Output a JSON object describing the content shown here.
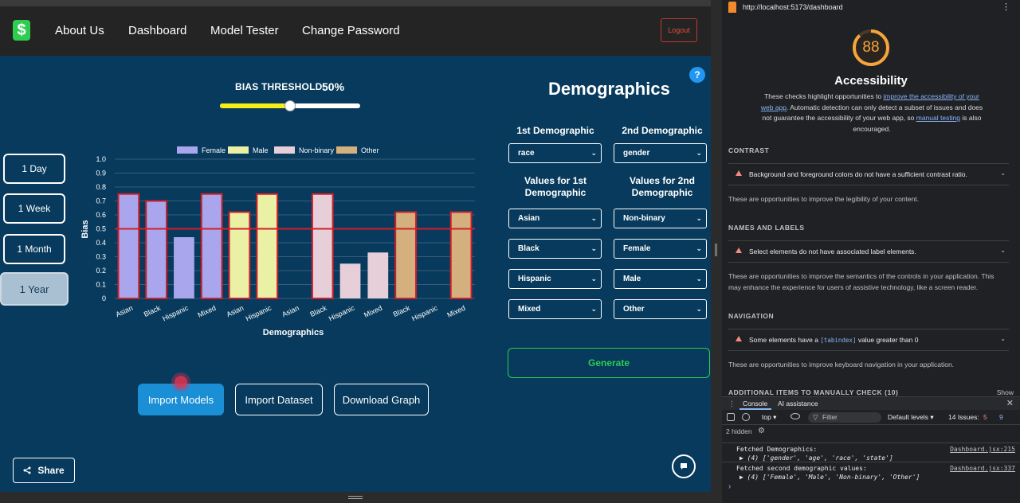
{
  "nav": {
    "logo_glyph": "$",
    "links": [
      "About Us",
      "Dashboard",
      "Model Tester",
      "Change Password"
    ],
    "logout": "Logout"
  },
  "threshold": {
    "label": "BIAS THRESHOLD:",
    "value_text": "50%",
    "value": 0.5
  },
  "help": "?",
  "ranges": [
    "1 Day",
    "1 Week",
    "1 Month",
    "1 Year"
  ],
  "active_range": "1 Year",
  "chart_data": {
    "type": "bar",
    "xlabel": "Demographics",
    "ylabel": "Bias",
    "ylim": [
      0,
      1.0
    ],
    "yticks": [
      "0",
      "0.1",
      "0.2",
      "0.3",
      "0.4",
      "0.5",
      "0.6",
      "0.7",
      "0.8",
      "0.9",
      "1.0"
    ],
    "threshold": 0.5,
    "legend": [
      {
        "name": "Female",
        "color": "#a9a6ee"
      },
      {
        "name": "Male",
        "color": "#eaf0a4"
      },
      {
        "name": "Non-binary",
        "color": "#e6cfd8"
      },
      {
        "name": "Other",
        "color": "#d4b07f"
      }
    ],
    "bars": [
      {
        "label": "Asian",
        "series": "Female",
        "value": 0.75,
        "flag": true
      },
      {
        "label": "Black",
        "series": "Female",
        "value": 0.7,
        "flag": true
      },
      {
        "label": "Hispanic",
        "series": "Female",
        "value": 0.44,
        "flag": false
      },
      {
        "label": "Mixed",
        "series": "Female",
        "value": 0.75,
        "flag": true
      },
      {
        "label": "Asian",
        "series": "Male",
        "value": 0.62,
        "flag": true
      },
      {
        "label": "Hispanic",
        "series": "Male",
        "value": 0.75,
        "flag": true
      },
      {
        "label": "Asian",
        "series": "Non-binary",
        "value": 0,
        "flag": false
      },
      {
        "label": "Black",
        "series": "Non-binary",
        "value": 0.75,
        "flag": true
      },
      {
        "label": "Hispanic",
        "series": "Non-binary",
        "value": 0.25,
        "flag": false
      },
      {
        "label": "Mixed",
        "series": "Non-binary",
        "value": 0.33,
        "flag": false
      },
      {
        "label": "Black",
        "series": "Other",
        "value": 0.62,
        "flag": true
      },
      {
        "label": "Hispanic",
        "series": "Other",
        "value": 0,
        "flag": false
      },
      {
        "label": "Mixed",
        "series": "Other",
        "value": 0.62,
        "flag": true
      }
    ],
    "colors": {
      "flag_border": "#d0202a",
      "threshold_line": "#d0202a",
      "grid": "#4a6a85"
    }
  },
  "demographics": {
    "title": "Demographics",
    "first_head": "1st Demographic",
    "second_head": "2nd Demographic",
    "first_selected": "race",
    "second_selected": "gender",
    "values_first_head_1": "Values for 1st",
    "values_first_head_2": "Demographic",
    "values_second_head_1": "Values for 2nd",
    "values_second_head_2": "Demographic",
    "first_values": [
      "Asian",
      "Black",
      "Hispanic",
      "Mixed"
    ],
    "second_values": [
      "Non-binary",
      "Female",
      "Male",
      "Other"
    ],
    "generate": "Generate"
  },
  "actions": {
    "import_models": "Import Models",
    "import_dataset": "Import Dataset",
    "download_graph": "Download Graph"
  },
  "share": "Share",
  "devtools": {
    "url": "http://localhost:5173/dashboard",
    "score": "88",
    "title": "Accessibility",
    "desc_1": "These checks highlight opportunities to ",
    "desc_link_1": "improve the accessibility of your web app",
    "desc_2": ". Automatic detection can only detect a subset of issues and does not guarantee the accessibility of your web app, so ",
    "desc_link_2": "manual testing",
    "desc_3": " is also encouraged.",
    "sections": [
      {
        "head": "CONTRAST",
        "audit": "Background and foreground colors do not have a sufficient contrast ratio.",
        "note": "These are opportunities to improve the legibility of your content."
      },
      {
        "head": "NAMES AND LABELS",
        "audit": "Select elements do not have associated label elements.",
        "note": "These are opportunities to improve the semantics of the controls in your application. This may enhance the experience for users of assistive technology, like a screen reader."
      },
      {
        "head": "NAVIGATION",
        "audit_pre": "Some elements have a ",
        "audit_code": "[tabindex]",
        "audit_post": " value greater than 0",
        "note": "These are opportunities to improve keyboard navigation in your application."
      }
    ],
    "manual_head": "ADDITIONAL ITEMS TO MANUALLY CHECK (10)",
    "manual_show": "Show",
    "tab_console": "Console",
    "tab_ai": "AI assistance",
    "ctx": "top ▾",
    "filter": "Filter",
    "levels": "Default levels ▾",
    "issues": "14 Issues:",
    "issues_err": "5",
    "issues_info": "9",
    "hidden": "2 hidden",
    "logs": [
      {
        "msg": "Fetched Demographics:",
        "val": "▶ (4) ['gender', 'age', 'race', 'state']",
        "src": "Dashboard.jsx:215"
      },
      {
        "msg": "Fetched second demographic values:",
        "val": "▶ (4) ['Female', 'Male', 'Non-binary', 'Other']",
        "src": "Dashboard.jsx:337"
      }
    ]
  }
}
